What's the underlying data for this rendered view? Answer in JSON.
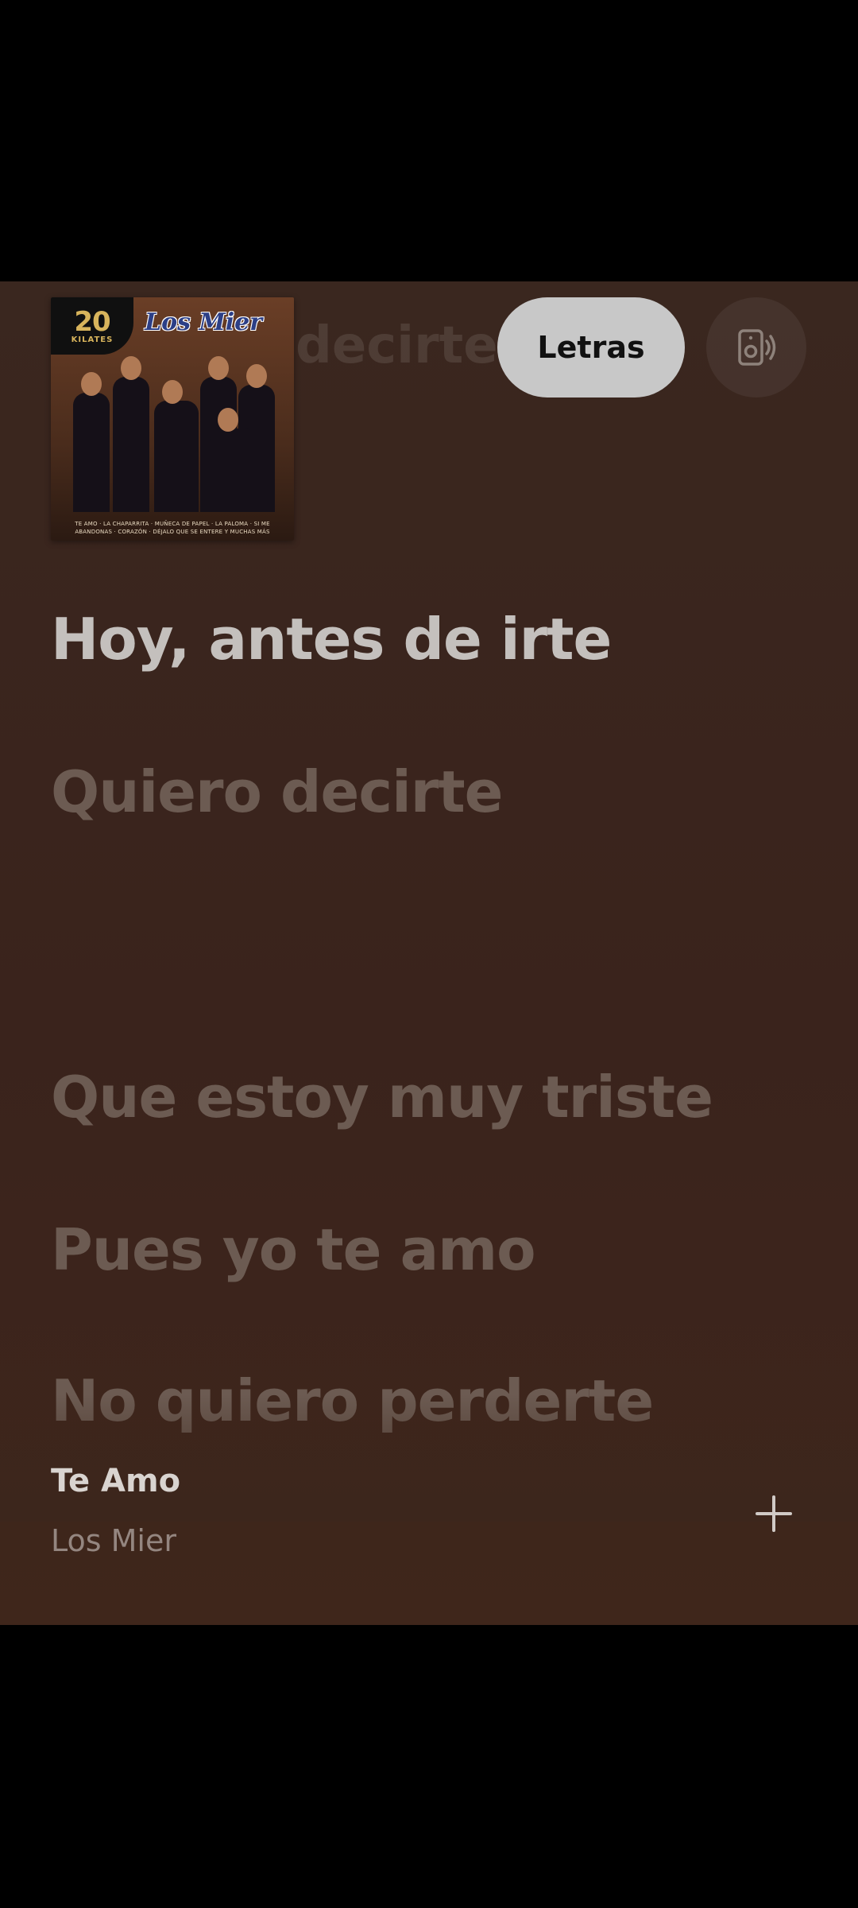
{
  "album": {
    "badge_number": "20",
    "badge_word": "KILATES",
    "artist_logo": "Los Mier",
    "credits": "TE AMO · LA CHAPARRITA · MUÑECA DE PAPEL · LA PALOMA · SI ME ABANDONAS · CORAZÓN · DÉJALO QUE SE ENTERE Y MUCHAS MÁS"
  },
  "header": {
    "ghost_lyric": "decirte",
    "lyrics_button_label": "Letras",
    "device_icon": "speaker-cast-icon"
  },
  "lyrics": [
    {
      "text": "Hoy, antes de irte",
      "state": "active"
    },
    {
      "text": "Quiero decirte",
      "state": "upcoming"
    },
    {
      "text": "Que estoy muy triste",
      "state": "upcoming"
    },
    {
      "text": "Pues yo te amo",
      "state": "upcoming"
    },
    {
      "text": "No quiero perderte",
      "state": "upcoming"
    }
  ],
  "track": {
    "title": "Te Amo",
    "artist": "Los Mier",
    "add_icon": "plus-icon"
  },
  "colors": {
    "panel_background": "#3a251d",
    "active_lyric": "#c4c0bd",
    "dim_lyric": "#6c5b52",
    "pill_background": "#c8c8c8"
  }
}
